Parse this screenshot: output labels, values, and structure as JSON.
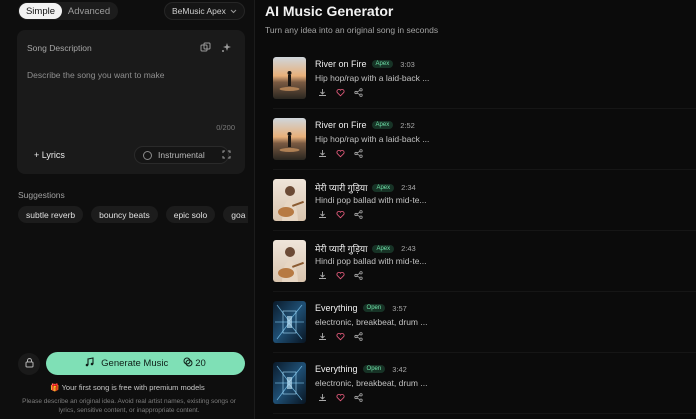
{
  "mode": {
    "simple": "Simple",
    "advanced": "Advanced"
  },
  "model": {
    "label": "BeMusic Apex"
  },
  "description": {
    "title": "Song Description",
    "placeholder": "Describe the song you want to make",
    "counter": "0/200"
  },
  "options": {
    "lyrics": "+ Lyrics",
    "instrumental": "Instrumental"
  },
  "suggestions": {
    "title": "Suggestions",
    "items": [
      "subtle reverb",
      "bouncy beats",
      "epic solo",
      "goa p"
    ]
  },
  "generate": {
    "label": "Generate Music",
    "credits": "20"
  },
  "notes": {
    "free": "Your first song is free with premium models",
    "fine_print": "Please describe an original idea. Avoid real artist names, existing songs or lyrics, sensitive content, or inappropriate content."
  },
  "header": {
    "title": "AI Music Generator",
    "subtitle": "Turn any idea into an original song in seconds"
  },
  "songs": [
    {
      "title": "River on Fire",
      "badge": "Apex",
      "duration": "3:03",
      "desc": "Hip hop/rap with a laid-back ...",
      "thumb": "sunset"
    },
    {
      "title": "River on Fire",
      "badge": "Apex",
      "duration": "2:52",
      "desc": "Hip hop/rap with a laid-back ...",
      "thumb": "sunset"
    },
    {
      "title": "मेरी प्यारी गुड़िया",
      "badge": "Apex",
      "duration": "2:34",
      "desc": "Hindi pop ballad with mid-te...",
      "thumb": "guitar"
    },
    {
      "title": "मेरी प्यारी गुड़िया",
      "badge": "Apex",
      "duration": "2:43",
      "desc": "Hindi pop ballad with mid-te...",
      "thumb": "guitar"
    },
    {
      "title": "Everything",
      "badge": "Open",
      "duration": "3:57",
      "desc": "electronic, breakbeat, drum ...",
      "thumb": "neon"
    },
    {
      "title": "Everything",
      "badge": "Open",
      "duration": "3:42",
      "desc": "electronic, breakbeat, drum ...",
      "thumb": "neon"
    }
  ],
  "colors": {
    "accent": "#7fe0b6",
    "badge_bg": "#173326",
    "badge_text": "#6fe0a8"
  }
}
